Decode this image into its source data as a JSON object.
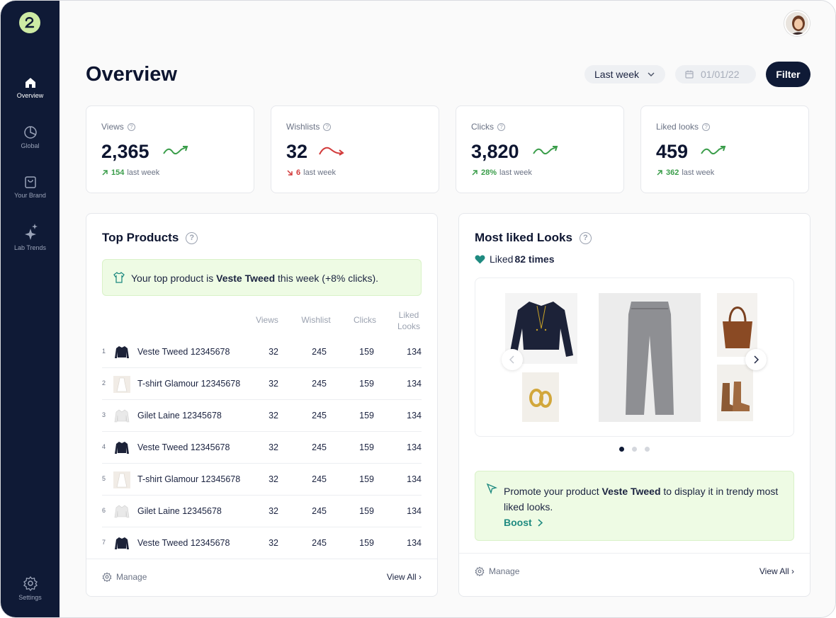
{
  "sidebar": {
    "items": [
      {
        "label": "Overview",
        "icon": "home-icon",
        "active": true
      },
      {
        "label": "Global",
        "icon": "pie-chart-icon",
        "active": false
      },
      {
        "label": "Your Brand",
        "icon": "shopping-bag-icon",
        "active": false
      },
      {
        "label": "Lab Trends",
        "icon": "sparkles-icon",
        "active": false
      }
    ],
    "settings_label": "Settings"
  },
  "header": {
    "title": "Overview",
    "period": "Last week",
    "date": "01/01/22",
    "filter_label": "Filter"
  },
  "stats": [
    {
      "label": "Views",
      "value": "2,365",
      "delta": "154",
      "delta_suffix": "last week",
      "direction": "up"
    },
    {
      "label": "Wishlists",
      "value": "32",
      "delta": "6",
      "delta_suffix": "last week",
      "direction": "down"
    },
    {
      "label": "Clicks",
      "value": "3,820",
      "delta": "28%",
      "delta_suffix": "last week",
      "direction": "up"
    },
    {
      "label": "Liked looks",
      "value": "459",
      "delta": "362",
      "delta_suffix": "last week",
      "direction": "up"
    }
  ],
  "top_products": {
    "title": "Top Products",
    "banner_prefix": "Your top product is ",
    "banner_product": "Veste Tweed",
    "banner_suffix": " this week (+8% clicks).",
    "columns": [
      "Views",
      "Wishlist",
      "Clicks",
      "Liked Looks"
    ],
    "rows": [
      {
        "rank": "1",
        "name": "Veste Tweed 12345678",
        "thumb": "jacket",
        "views": "32",
        "wishlist": "245",
        "clicks": "159",
        "liked": "134"
      },
      {
        "rank": "2",
        "name": "T-shirt Glamour 12345678",
        "thumb": "dress",
        "views": "32",
        "wishlist": "245",
        "clicks": "159",
        "liked": "134"
      },
      {
        "rank": "3",
        "name": "Gilet Laine 12345678",
        "thumb": "cardigan",
        "views": "32",
        "wishlist": "245",
        "clicks": "159",
        "liked": "134"
      },
      {
        "rank": "4",
        "name": "Veste Tweed 12345678",
        "thumb": "jacket",
        "views": "32",
        "wishlist": "245",
        "clicks": "159",
        "liked": "134"
      },
      {
        "rank": "5",
        "name": "T-shirt Glamour 12345678",
        "thumb": "dress",
        "views": "32",
        "wishlist": "245",
        "clicks": "159",
        "liked": "134"
      },
      {
        "rank": "6",
        "name": "Gilet Laine 12345678",
        "thumb": "cardigan",
        "views": "32",
        "wishlist": "245",
        "clicks": "159",
        "liked": "134"
      },
      {
        "rank": "7",
        "name": "Veste Tweed 12345678",
        "thumb": "jacket",
        "views": "32",
        "wishlist": "245",
        "clicks": "159",
        "liked": "134"
      }
    ],
    "manage_label": "Manage",
    "view_all_label": "View All ›"
  },
  "liked_looks": {
    "title": "Most liked Looks",
    "liked_prefix": "Liked ",
    "liked_count": "82 times",
    "carousel_dots": 3,
    "carousel_active": 0,
    "promo_prefix": "Promote your product ",
    "promo_product": "Veste Tweed",
    "promo_suffix": " to display it in trendy most liked looks.",
    "boost_label": "Boost",
    "manage_label": "Manage",
    "view_all_label": "View All ›"
  },
  "colors": {
    "sidebar_bg": "#0f1a36",
    "up": "#3a9d4a",
    "down": "#d23b3b",
    "accent_teal": "#1f8a80",
    "banner_bg": "#eefbe4"
  }
}
